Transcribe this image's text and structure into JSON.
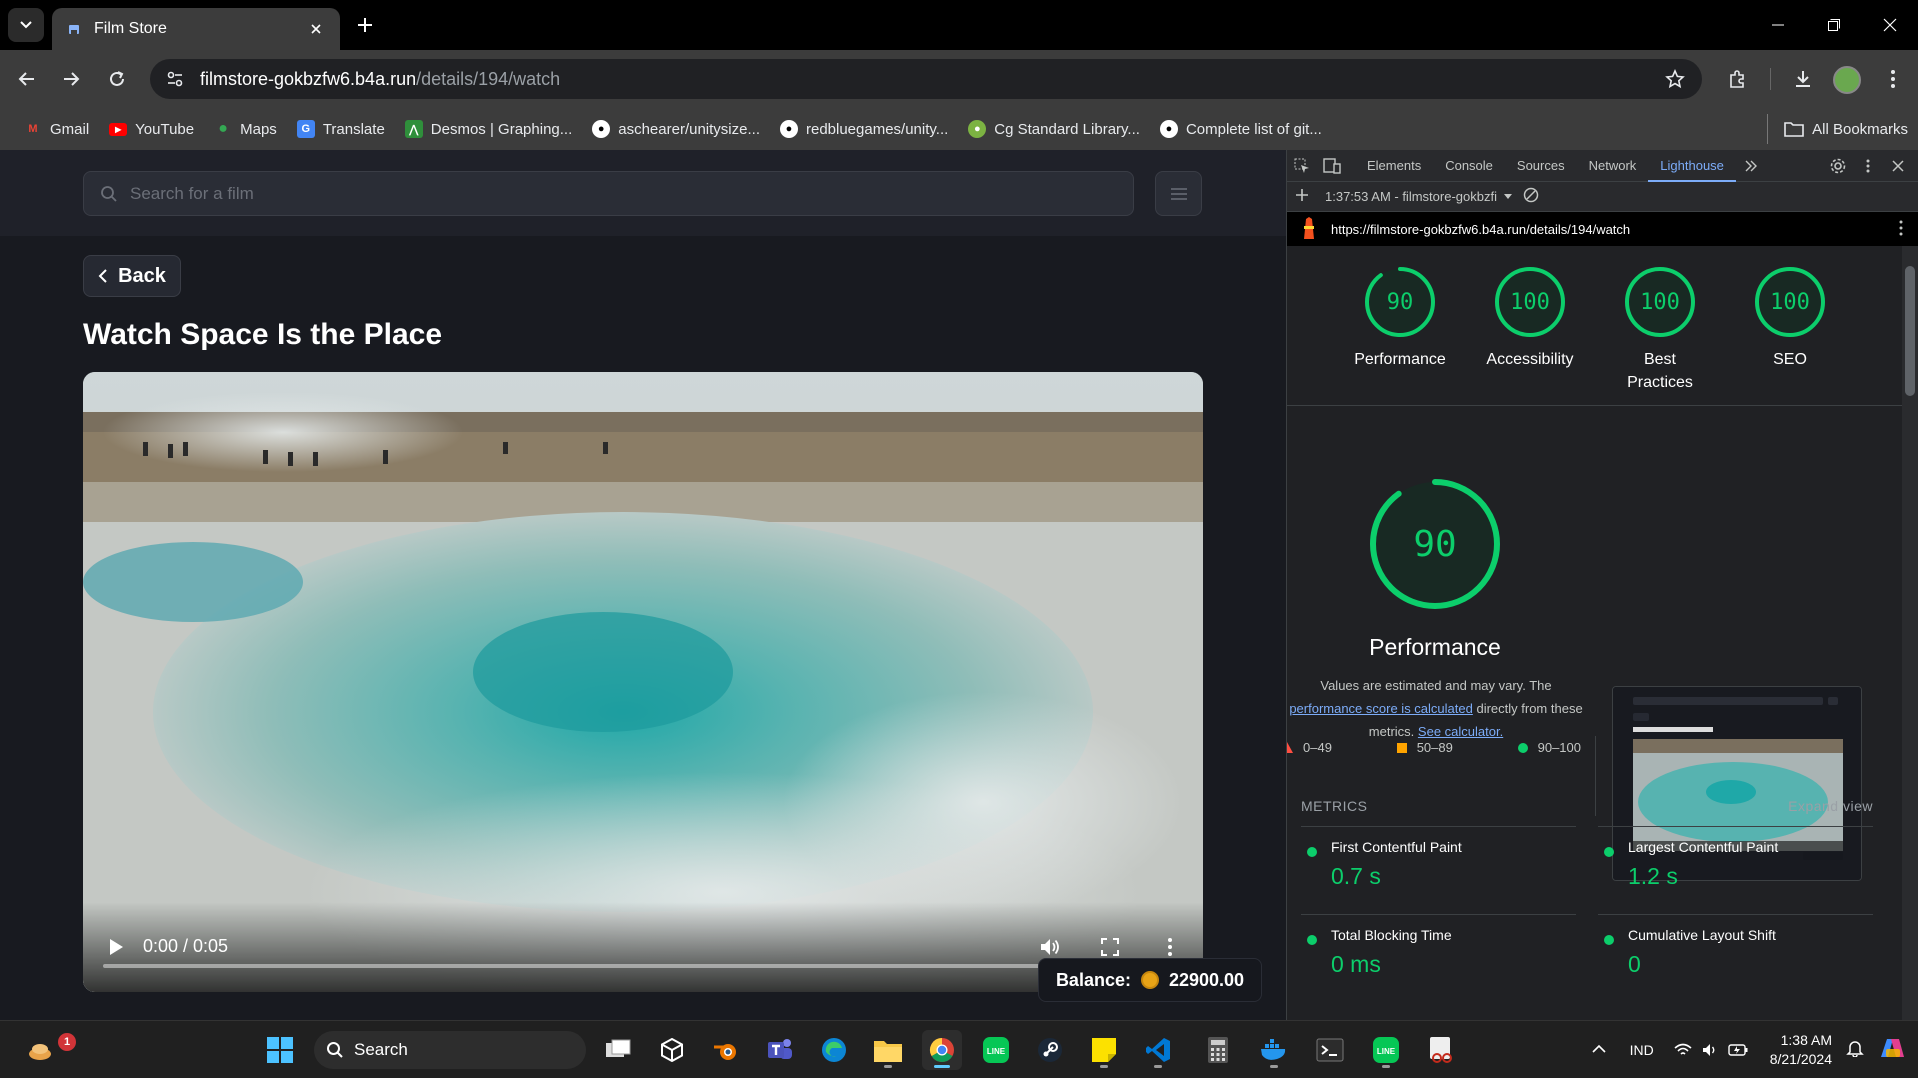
{
  "browser": {
    "tab_title": "Film Store",
    "url_host": "filmstore-gokbzfw6.b4a.run",
    "url_path": "/details/194/watch",
    "bookmarks": [
      {
        "label": "Gmail",
        "icon": "gmail-icon",
        "color": "#ea4335"
      },
      {
        "label": "YouTube",
        "icon": "youtube-icon",
        "color": "#ff0000"
      },
      {
        "label": "Maps",
        "icon": "maps-icon",
        "color": "#34a853"
      },
      {
        "label": "Translate",
        "icon": "translate-icon",
        "color": "#4285f4"
      },
      {
        "label": "Desmos | Graphing...",
        "icon": "desmos-icon",
        "color": "#2f8f3b"
      },
      {
        "label": "aschearer/unitysize...",
        "icon": "github-icon",
        "color": "#ffffff"
      },
      {
        "label": "redbluegames/unity...",
        "icon": "github-icon",
        "color": "#ffffff"
      },
      {
        "label": "Cg Standard Library...",
        "icon": "cg-icon",
        "color": "#7cb342"
      },
      {
        "label": "Complete list of git...",
        "icon": "github-icon",
        "color": "#ffffff"
      }
    ],
    "all_bookmarks": "All Bookmarks"
  },
  "page": {
    "search_placeholder": "Search for a film",
    "back_label": "Back",
    "title": "Watch Space Is the Place",
    "video": {
      "time": "0:00 / 0:05",
      "progress": 0
    },
    "balance_label": "Balance:",
    "balance_value": "22900.00"
  },
  "devtools": {
    "tabs": [
      "Elements",
      "Console",
      "Sources",
      "Network",
      "Lighthouse"
    ],
    "active_tab": "Lighthouse",
    "report_selector": "1:37:53 AM - filmstore-gokbzfi",
    "report_url": "https://filmstore-gokbzfw6.b4a.run/details/194/watch",
    "scores": [
      {
        "value": "90",
        "label": "Performance"
      },
      {
        "value": "100",
        "label": "Accessibility"
      },
      {
        "value": "100",
        "label": "Best Practices"
      },
      {
        "value": "100",
        "label": "SEO"
      }
    ],
    "performance": {
      "score": "90",
      "title": "Performance",
      "note_prefix": "Values are estimated and may vary. The",
      "note_link": "performance score is calculated",
      "note_mid": "directly from these metrics.",
      "note_link2": "See calculator.",
      "legend": [
        "0–49",
        "50–89",
        "90–100"
      ]
    },
    "metrics_header": "METRICS",
    "expand_view": "Expand view",
    "metrics": [
      {
        "name": "First Contentful Paint",
        "value": "0.7 s"
      },
      {
        "name": "Largest Contentful Paint",
        "value": "1.2 s"
      },
      {
        "name": "Total Blocking Time",
        "value": "0 ms"
      },
      {
        "name": "Cumulative Layout Shift",
        "value": "0"
      }
    ]
  },
  "taskbar": {
    "search_label": "Search",
    "notification_count": "1",
    "lang": "IND",
    "time": "1:38 AM",
    "date": "8/21/2024"
  },
  "colors": {
    "pass_green": "#0cce6b",
    "average_orange": "#ffa400",
    "fail_red": "#ff4e42",
    "link_blue": "#7cacf8"
  }
}
